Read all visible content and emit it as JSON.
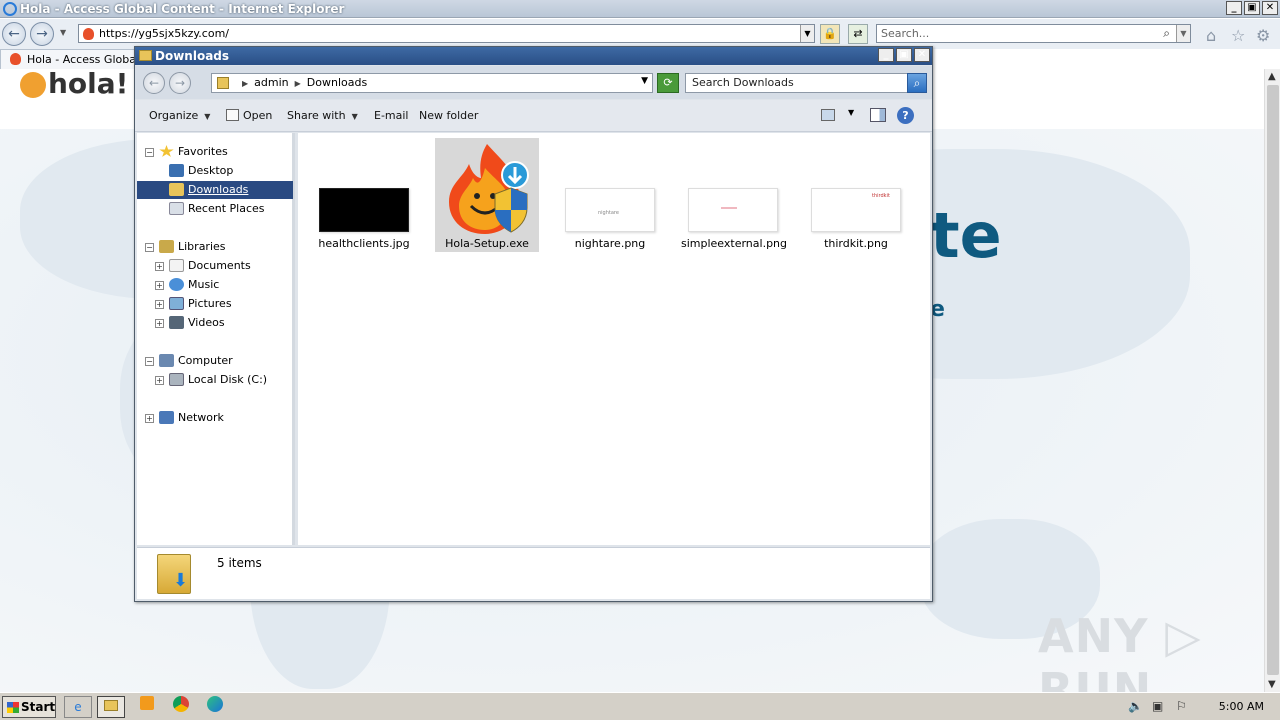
{
  "ie": {
    "title": "Hola - Access Global Content - Internet Explorer",
    "url": "https://yg5sjx5kzy.com/",
    "search_placeholder": "Search...",
    "tab_label": "Hola - Access Global C",
    "caption_min": "_",
    "caption_max": "▣",
    "caption_close": "✕"
  },
  "web": {
    "logo_text": "hola!",
    "hero_fragment_1": "te",
    "hero_fragment_2": "e",
    "watermark": "ANY ▷ RUN"
  },
  "explorer": {
    "title": "Downloads",
    "crumbs": [
      "admin",
      "Downloads"
    ],
    "search_placeholder": "Search Downloads",
    "toolbar": {
      "organize": "Organize",
      "open": "Open",
      "share_with": "Share with",
      "email": "E-mail",
      "new_folder": "New folder"
    },
    "nav": {
      "favorites": "Favorites",
      "desktop": "Desktop",
      "downloads": "Downloads",
      "recent_places": "Recent Places",
      "libraries": "Libraries",
      "documents": "Documents",
      "music": "Music",
      "pictures": "Pictures",
      "videos": "Videos",
      "computer": "Computer",
      "local_disk": "Local Disk (C:)",
      "network": "Network"
    },
    "files": [
      {
        "name": "healthclients.jpg"
      },
      {
        "name": "Hola-Setup.exe"
      },
      {
        "name": "nightare.png",
        "thumb_text": "nightare"
      },
      {
        "name": "simpleexternal.png"
      },
      {
        "name": "thirdkit.png",
        "thumb_text": "thirdkit"
      }
    ],
    "status_count": "5 items"
  },
  "taskbar": {
    "start_label": "Start",
    "clock": "5:00 AM"
  },
  "colors": {
    "explorer_title_bg": "#2a4f86",
    "selection": "#2a4a82",
    "hola_blue": "#0f5a80"
  }
}
